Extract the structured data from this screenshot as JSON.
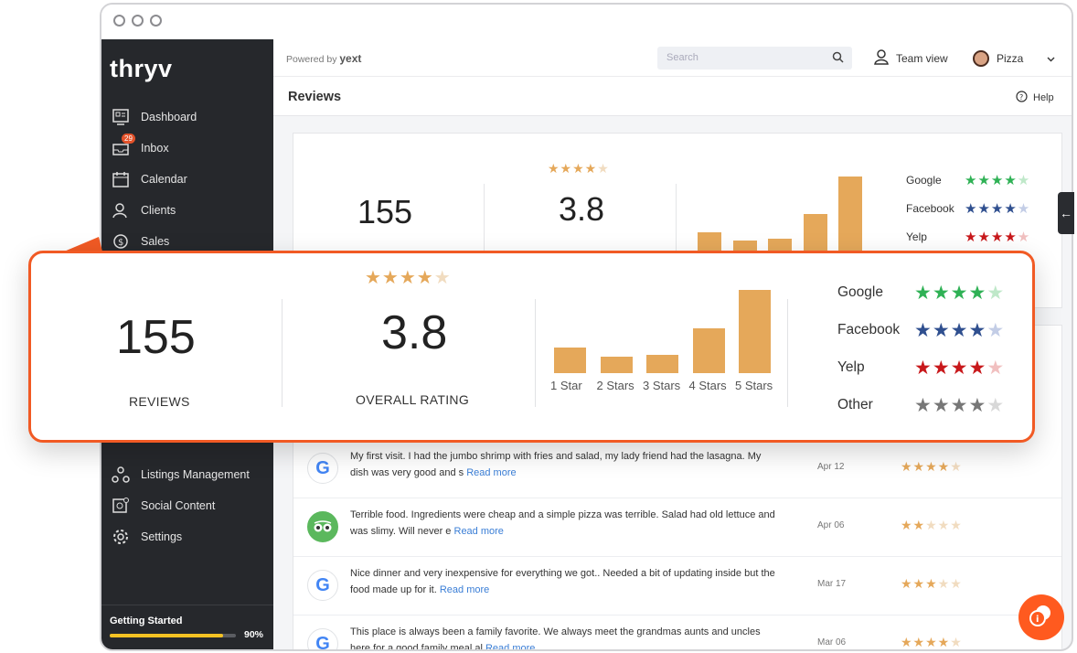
{
  "app": {
    "logo": "thryv"
  },
  "sidebar": {
    "items": [
      {
        "label": "Dashboard",
        "icon": "dashboard-icon"
      },
      {
        "label": "Inbox",
        "icon": "inbox-icon",
        "badge": "29"
      },
      {
        "label": "Calendar",
        "icon": "calendar-icon"
      },
      {
        "label": "Clients",
        "icon": "clients-icon"
      },
      {
        "label": "Sales",
        "icon": "sales-icon"
      },
      {
        "label": "Listings Management",
        "icon": "listings-icon"
      },
      {
        "label": "Social Content",
        "icon": "social-content-icon"
      },
      {
        "label": "Settings",
        "icon": "gear-icon"
      }
    ],
    "getting_started": {
      "label": "Getting Started",
      "percent_label": "90%",
      "progress": 0.9
    }
  },
  "topbar": {
    "powered_by": "Powered by",
    "powered_brand": "yext",
    "search_placeholder": "Search",
    "team_view": "Team view",
    "user_name": "Pizza"
  },
  "page": {
    "title": "Reviews",
    "help": "Help"
  },
  "summary": {
    "reviews_count": "155",
    "reviews_label": "REVIEWS",
    "rating": "3.8",
    "rating_label": "OVERALL RATING",
    "rating_stars": "★★★★",
    "rating_star_empty": "★",
    "sources": [
      {
        "name": "Google",
        "color": "#2fb155",
        "filled": 4
      },
      {
        "name": "Facebook",
        "color": "#2f4f8f",
        "filled": 4
      },
      {
        "name": "Yelp",
        "color": "#c8181b",
        "filled": 4
      },
      {
        "name": "Other",
        "color": "#777777",
        "filled": 4
      }
    ]
  },
  "chart_data": {
    "type": "bar",
    "categories": [
      "1 Star",
      "2 Stars",
      "3 Stars",
      "4 Stars",
      "5 Stars"
    ],
    "values": [
      14,
      9,
      10,
      24,
      45
    ],
    "ylim": [
      0,
      45
    ],
    "grid": false,
    "color": "#e5a85a"
  },
  "reviews": [
    {
      "source": "google",
      "text": "My first visit. I had the jumbo shrimp with fries and salad, my lady friend had the lasagna. My dish was very good and s",
      "read_more": "Read more",
      "date": "Apr 12",
      "stars": 4
    },
    {
      "source": "tripadvisor",
      "text": "Terrible food. Ingredients were cheap and a simple pizza was terrible. Salad had old lettuce and was slimy. Will never e",
      "read_more": "Read more",
      "date": "Apr 06",
      "stars": 2
    },
    {
      "source": "google",
      "text": "Nice dinner and very inexpensive for everything we got.. Needed a bit of updating inside but the food made up for it.",
      "read_more": "Read more",
      "date": "Mar 17",
      "stars": 3
    },
    {
      "source": "google",
      "text": "This place is always been a family favorite. We always meet the grandmas aunts and uncles here for a good family meal al",
      "read_more": "Read more",
      "date": "Mar 06",
      "stars": 4
    }
  ],
  "colors": {
    "accent": "#f15a24",
    "star": "#e5a85a",
    "star_empty": "#f1dcc0",
    "sidebar": "#26282c"
  }
}
